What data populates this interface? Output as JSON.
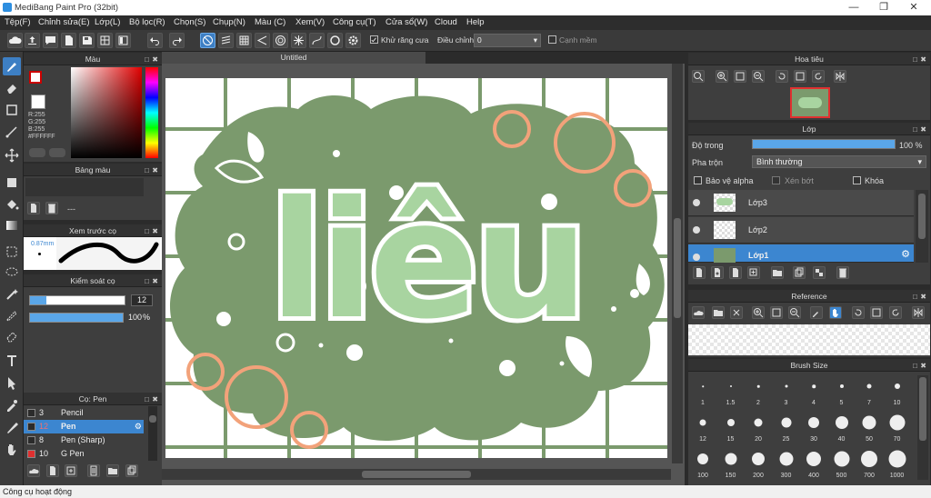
{
  "app": {
    "title": "MediBang Paint Pro (32bit)"
  },
  "menu": [
    "Tệp(F)",
    "Chỉnh sửa(E)",
    "Lớp(L)",
    "Bộ lọc(R)",
    "Chọn(S)",
    "Chụp(N)",
    "Màu (C)",
    "Xem(V)",
    "Công cụ(T)",
    "Cửa sổ(W)",
    "Cloud",
    "Help"
  ],
  "toolbar": {
    "antialias_label": "Khử răng cưa",
    "adjust_label": "Điều chỉnh",
    "adjust_value": "0",
    "edge_label": "Cạnh mềm"
  },
  "color_panel": {
    "title": "Màu",
    "r": "R:255",
    "g": "G:255",
    "b": "B:255",
    "hex": "#FFFFFF"
  },
  "palette_panel": {
    "title": "Bảng màu",
    "value": "---"
  },
  "brush_preview": {
    "title": "Xem trước cọ",
    "size": "0.87mm"
  },
  "brush_control": {
    "title": "Kiểm soát cọ",
    "size_value": "12",
    "opacity_value": "100",
    "opacity_unit": "%",
    "size_fraction": 0.17,
    "opacity_fraction": 1.0
  },
  "brush_panel": {
    "title": "Cọ: Pen",
    "items": [
      {
        "num": "3",
        "name": "Pencil",
        "color": "#2b2b2b"
      },
      {
        "num": "12",
        "name": "Pen",
        "color": "#2b2b2b"
      },
      {
        "num": "8",
        "name": "Pen (Sharp)",
        "color": "#2b2b2b"
      },
      {
        "num": "10",
        "name": "G Pen",
        "color": "#e03030"
      }
    ]
  },
  "document": {
    "tab": "Untitled",
    "text": "liêu"
  },
  "navigator": {
    "title": "Hoa tiêu"
  },
  "layers": {
    "title": "Lớp",
    "opacity_label": "Độ trong",
    "opacity_value": "100 %",
    "opacity_fraction": 1.0,
    "blend_label": "Pha trộn",
    "blend_value": "Bình thường",
    "protect_alpha": "Bảo vệ alpha",
    "clipping": "Xén bớt",
    "lock": "Khóa",
    "items": [
      {
        "name": "Lớp3"
      },
      {
        "name": "Lớp2"
      },
      {
        "name": "Lớp1"
      }
    ]
  },
  "reference": {
    "title": "Reference"
  },
  "brush_size": {
    "title": "Brush Size",
    "sizes": [
      "1",
      "1.5",
      "2",
      "3",
      "4",
      "5",
      "7",
      "10",
      "12",
      "15",
      "20",
      "25",
      "30",
      "40",
      "50",
      "70",
      "100",
      "150",
      "200",
      "300",
      "400",
      "500",
      "700",
      "1000"
    ]
  },
  "status": {
    "text": "Công cụ hoạt động"
  },
  "colors": {
    "accent": "#3c86d0",
    "canvas_green": "#7b9a6d",
    "orange": "#f2a27a",
    "light_green": "#a8d4a0"
  }
}
